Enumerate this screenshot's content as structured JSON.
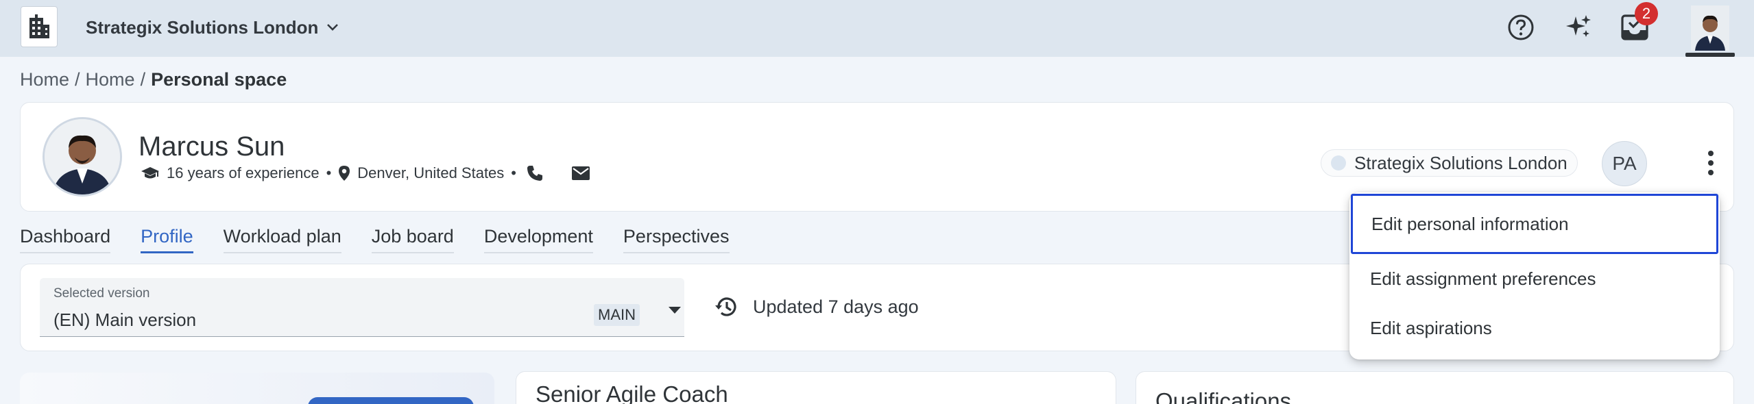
{
  "topbar": {
    "org_name": "Strategix Solutions London",
    "notification_count": "2",
    "icons": [
      "building-icon",
      "chevron-down-icon",
      "help-icon",
      "sparkles-icon",
      "inbox-tasks-icon"
    ]
  },
  "breadcrumb": {
    "items": [
      "Home",
      "Home"
    ],
    "separator": "/",
    "current": "Personal space"
  },
  "profile": {
    "name": "Marcus Sun",
    "experience": "16 years of experience",
    "location": "Denver, United States",
    "dot": "•",
    "org_chip": "Strategix Solutions London",
    "initials": "PA"
  },
  "tabs": [
    {
      "label": "Dashboard",
      "active": false
    },
    {
      "label": "Profile",
      "active": true
    },
    {
      "label": "Workload plan",
      "active": false
    },
    {
      "label": "Job board",
      "active": false
    },
    {
      "label": "Development",
      "active": false
    },
    {
      "label": "Perspectives",
      "active": false
    }
  ],
  "version": {
    "label": "Selected version",
    "value": "(EN) Main version",
    "tag": "MAIN",
    "updated": "Updated 7 days ago"
  },
  "cards": {
    "mid_title": "Senior Agile Coach",
    "right_title": "Qualifications"
  },
  "menu": {
    "items": [
      "Edit personal information",
      "Edit assignment preferences",
      "Edit aspirations"
    ]
  },
  "colors": {
    "accent": "#3266c4",
    "topbar_bg": "#dde6ef",
    "focus_border": "#1f46d6",
    "badge": "#d32f2f"
  }
}
